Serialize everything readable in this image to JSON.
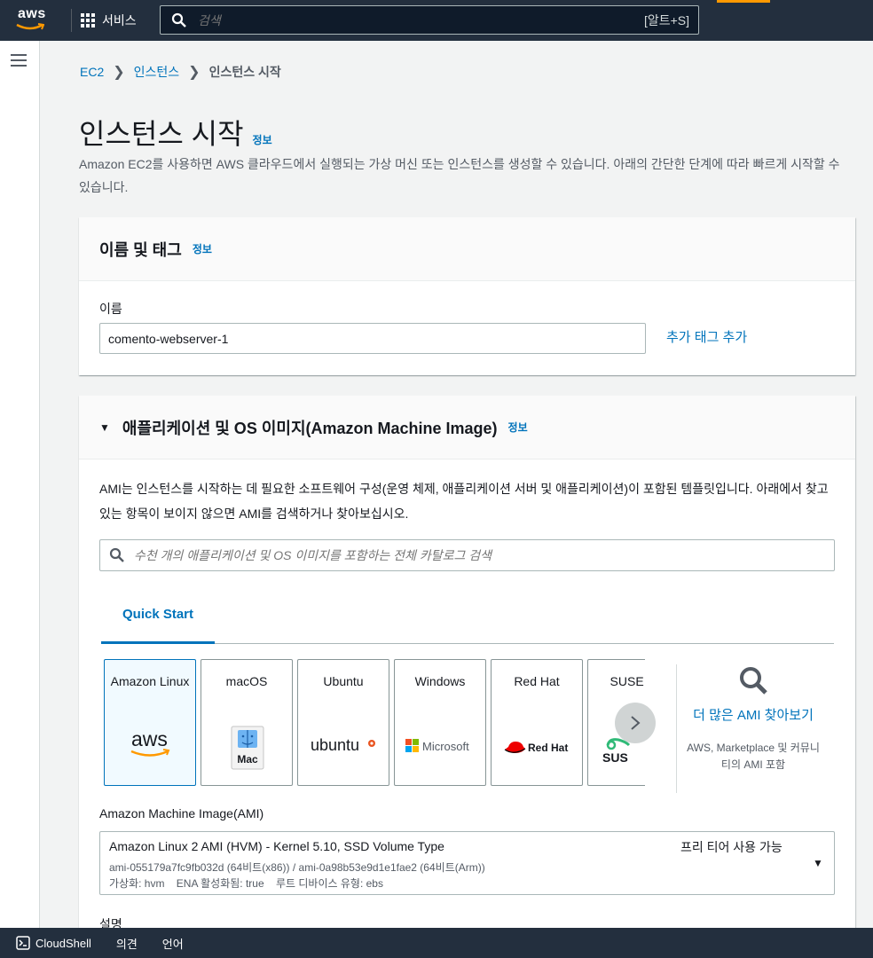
{
  "topnav": {
    "logo_text": "aws",
    "services_label": "서비스",
    "search_placeholder": "검색",
    "search_shortcut": "[알트+S]"
  },
  "breadcrumb": {
    "root": "EC2",
    "parent": "인스턴스",
    "current": "인스턴스 시작"
  },
  "page": {
    "title": "인스턴스 시작",
    "info": "정보",
    "description": "Amazon EC2를 사용하면 AWS 클라우드에서 실행되는 가상 머신 또는 인스턴스를 생성할 수 있습니다. 아래의 간단한 단계에 따라 빠르게 시작할 수 있습니다."
  },
  "name_panel": {
    "title": "이름 및 태그",
    "info": "정보",
    "name_label": "이름",
    "name_value": "comento-webserver-1",
    "add_tag": "추가 태그 추가"
  },
  "ami_panel": {
    "title": "애플리케이션 및 OS 이미지(Amazon Machine Image)",
    "info": "정보",
    "description": "AMI는 인스턴스를 시작하는 데 필요한 소프트웨어 구성(운영 체제, 애플리케이션 서버 및 애플리케이션)이 포함된 템플릿입니다. 아래에서 찾고 있는 항목이 보이지 않으면 AMI를 검색하거나 찾아보십시오.",
    "search_placeholder": "수천 개의 애플리케이션 및 OS 이미지를 포함하는 전체 카탈로그 검색",
    "tab": "Quick Start",
    "os_options": [
      {
        "name": "Amazon Linux",
        "logo": "aws",
        "selected": true
      },
      {
        "name": "macOS",
        "logo": "Mac"
      },
      {
        "name": "Ubuntu",
        "logo": "ubuntu"
      },
      {
        "name": "Windows",
        "logo": "Microsoft"
      },
      {
        "name": "Red Hat",
        "logo": "Red Hat"
      },
      {
        "name": "SUSE Li",
        "logo": "SUS"
      }
    ],
    "more_link": "더 많은 AMI 찾아보기",
    "more_sub": "AWS, Marketplace 및 커뮤니티의 AMI 포함",
    "ami_label": "Amazon Machine Image(AMI)",
    "ami_selected": {
      "title": "Amazon Linux 2 AMI (HVM) - Kernel 5.10, SSD Volume Type",
      "ids": "ami-055179a7fc9fb032d (64비트(x86)) / ami-0a98b53e9d1e1fae2 (64비트(Arm))",
      "attrs": "가상화: hvm    ENA 활성화됨: true    루트 디바이스 유형: ebs",
      "free_tier": "프리 티어 사용 가능"
    },
    "desc_label": "설명"
  },
  "footer": {
    "cloudshell": "CloudShell",
    "feedback": "의견",
    "language": "언어"
  },
  "colors": {
    "nav": "#232f3e",
    "link": "#0073bb",
    "accent": "#ff9900",
    "selected_bg": "#f1faff"
  }
}
